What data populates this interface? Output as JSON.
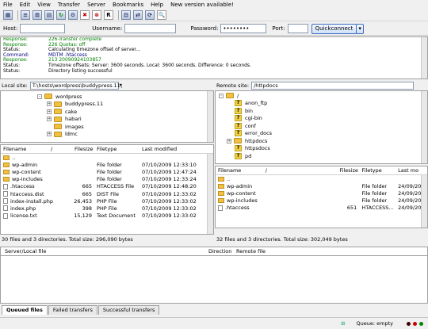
{
  "menu": [
    "File",
    "Edit",
    "View",
    "Transfer",
    "Server",
    "Bookmarks",
    "Help",
    "New version available!"
  ],
  "toolbar_icons": [
    "site-manager-icon",
    "toggle-log-icon",
    "toggle-tree-icon",
    "toggle-queue-icon",
    "refresh-icon",
    "process-queue-icon",
    "cancel-icon",
    "disconnect-icon",
    "reconnect-icon",
    "filter-icon",
    "compare-icon",
    "sync-browse-icon",
    "search-icon"
  ],
  "quickconnect": {
    "host_label": "Host:",
    "host_value": "",
    "username_label": "Username:",
    "username_value": "",
    "password_label": "Password:",
    "password_value": "••••••••",
    "port_label": "Port:",
    "port_value": "",
    "button": "Quickconnect"
  },
  "log": [
    {
      "k": "Response:",
      "v": "226-Transfer complete",
      "t": "resp"
    },
    {
      "k": "Response:",
      "v": "226 Quotas: off",
      "t": "resp"
    },
    {
      "k": "Status:",
      "v": "Calculating timezone offset of server...",
      "t": "status"
    },
    {
      "k": "Command:",
      "v": "MDTM .htaccess",
      "t": "cmd"
    },
    {
      "k": "Response:",
      "v": "213 20090924103857",
      "t": "resp"
    },
    {
      "k": "Status:",
      "v": "Timezone offsets: Server: 3600 seconds. Local: 3600 seconds. Difference: 0 seconds.",
      "t": "status"
    },
    {
      "k": "Status:",
      "v": "Directory listing successful",
      "t": "status"
    }
  ],
  "local": {
    "label": "Local site:",
    "path": "T:\\hosts\\wordpress\\buddypress.11\\",
    "tree": [
      {
        "name": "wordpress",
        "exp": "-"
      },
      {
        "name": "buddypress.11",
        "exp": "+"
      },
      {
        "name": "cake",
        "exp": "+"
      },
      {
        "name": "habari",
        "exp": "+"
      },
      {
        "name": "images",
        "exp": ""
      },
      {
        "name": "ldmc",
        "exp": "+"
      }
    ],
    "headers": [
      "Filename",
      "/",
      "Filesize",
      "Filetype",
      "Last modified"
    ],
    "files": [
      {
        "name": "..",
        "size": "",
        "type": "",
        "mod": "",
        "kind": "folder"
      },
      {
        "name": "wp-admin",
        "size": "",
        "type": "File folder",
        "mod": "07/10/2009 12:33:10",
        "kind": "folder"
      },
      {
        "name": "wp-content",
        "size": "",
        "type": "File folder",
        "mod": "07/10/2009 12:47:24",
        "kind": "folder"
      },
      {
        "name": "wp-includes",
        "size": "",
        "type": "File folder",
        "mod": "07/10/2009 12:33:24",
        "kind": "folder"
      },
      {
        "name": ".htaccess",
        "size": "665",
        "type": "HTACCESS File",
        "mod": "07/10/2009 12:48:20",
        "kind": "file"
      },
      {
        "name": "htaccess.dist",
        "size": "665",
        "type": "DIST File",
        "mod": "07/10/2009 12:33:02",
        "kind": "file"
      },
      {
        "name": "index-install.php",
        "size": "26,453",
        "type": "PHP File",
        "mod": "07/10/2009 12:33:02",
        "kind": "file"
      },
      {
        "name": "index.php",
        "size": "398",
        "type": "PHP File",
        "mod": "07/10/2009 12:33:02",
        "kind": "file"
      },
      {
        "name": "license.txt",
        "size": "15,129",
        "type": "Text Document",
        "mod": "07/10/2009 12:33:02",
        "kind": "file"
      }
    ],
    "status": "30 files and 3 directories. Total size: 296,090 bytes"
  },
  "remote": {
    "label": "Remote site:",
    "path": "/httpdocs",
    "tree": [
      {
        "name": "/",
        "icon": "folder",
        "exp": "-"
      },
      {
        "name": "anon_ftp",
        "icon": "q"
      },
      {
        "name": "bin",
        "icon": "q"
      },
      {
        "name": "cgi-bin",
        "icon": "q"
      },
      {
        "name": "conf",
        "icon": "q"
      },
      {
        "name": "error_docs",
        "icon": "q"
      },
      {
        "name": "httpdocs",
        "icon": "folder",
        "exp": "+"
      },
      {
        "name": "httpsdocs",
        "icon": "q"
      },
      {
        "name": "pd",
        "icon": "q"
      }
    ],
    "headers": [
      "Filename",
      "/",
      "Filesize",
      "Filetype",
      "Last mo"
    ],
    "files": [
      {
        "name": "..",
        "size": "",
        "type": "",
        "mod": "",
        "kind": "folder"
      },
      {
        "name": "wp-admin",
        "size": "",
        "type": "File folder",
        "mod": "24/09/20",
        "kind": "folder"
      },
      {
        "name": "wp-content",
        "size": "",
        "type": "File folder",
        "mod": "24/09/20",
        "kind": "folder"
      },
      {
        "name": "wp-includes",
        "size": "",
        "type": "File folder",
        "mod": "24/09/20",
        "kind": "folder"
      },
      {
        "name": ".htaccess",
        "size": "651",
        "type": "HTACCESS...",
        "mod": "24/09/20",
        "kind": "file"
      }
    ],
    "status": "32 files and 3 directories. Total size: 302,049 bytes"
  },
  "queue": {
    "headers": [
      "Server/Local file",
      "Direction",
      "Remote file"
    ],
    "tabs": [
      "Queued files",
      "Failed transfers",
      "Successful transfers"
    ]
  },
  "statusbar": {
    "queue": "Queue: empty"
  }
}
